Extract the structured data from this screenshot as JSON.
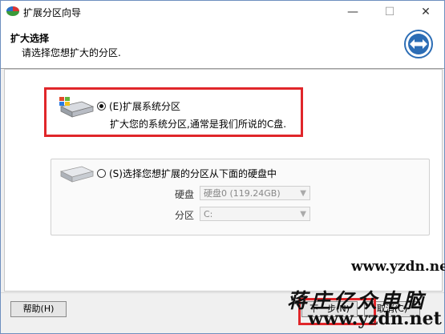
{
  "window": {
    "title": "扩展分区向导",
    "controls": {
      "minimize": "—",
      "maximize": "☐",
      "close": "✕"
    }
  },
  "header": {
    "title": "扩大选择",
    "subtitle": "请选择您想扩大的分区."
  },
  "options": [
    {
      "label": "(E)扩展系统分区",
      "description": "扩大您的系统分区,通常是我们所说的C盘.",
      "selected": true,
      "icon": "windows-drive-icon"
    },
    {
      "label": "(S)选择您想扩展的分区从下面的硬盘中",
      "selected": false,
      "icon": "hard-drive-icon",
      "fields": {
        "disk_label": "硬盘",
        "disk_value": "硬盘0 (119.24GB)",
        "partition_label": "分区",
        "partition_value": "C:"
      }
    }
  ],
  "buttons": {
    "help": "帮助(H)",
    "next": "下一步(N)",
    "cancel": "取消(C)"
  },
  "watermark": {
    "line1": "蒋庄亿众电脑",
    "line2": "www.yzdn.net",
    "top": "www.yzdn.net"
  },
  "colors": {
    "highlight": "#e0262a",
    "logo_blue": "#2c6db5"
  }
}
